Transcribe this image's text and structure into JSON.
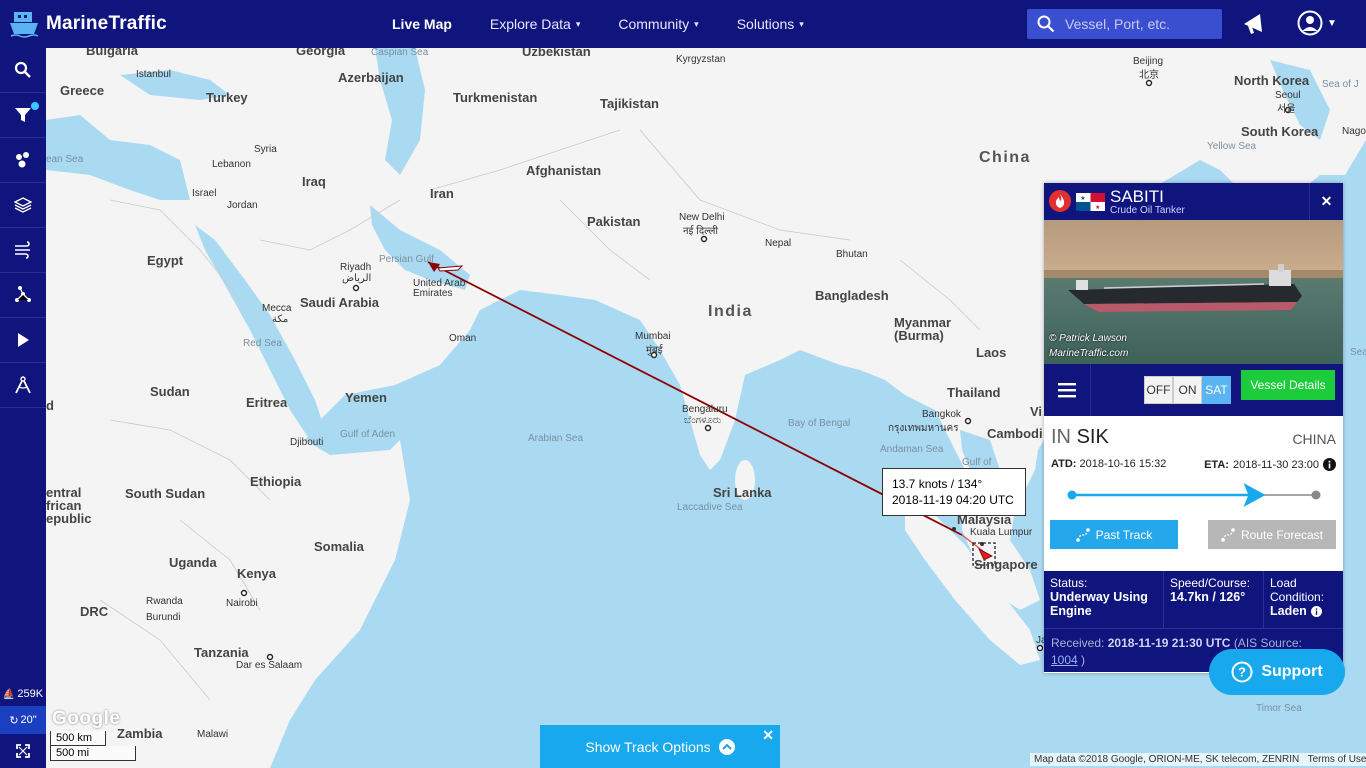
{
  "app": {
    "name": "MarineTraffic"
  },
  "nav": {
    "live_map": "Live Map",
    "explore_data": "Explore Data",
    "community": "Community",
    "solutions": "Solutions"
  },
  "search": {
    "placeholder": "Vessel, Port, etc."
  },
  "sidebar": {
    "stat_vessels": "259K",
    "stat_refresh": "20\""
  },
  "map": {
    "labels": {
      "bulgaria": "Bulgaria",
      "georgia": "Georgia",
      "caspian_sea": "Caspian Sea",
      "uzbekistan": "Uzbekistan",
      "kyrgyzstan": "Kyrgyzstan",
      "beijing": "Beijing",
      "beijing_cn": "北京",
      "north_korea": "North Korea",
      "seoul": "Seoul",
      "seoul_kr": "서울",
      "sea_of_japan": "Sea of J",
      "istanbul": "Istanbul",
      "greece": "Greece",
      "turkey": "Turkey",
      "azerbaijan": "Azerbaijan",
      "turkmenistan": "Turkmenistan",
      "tajikistan": "Tajikistan",
      "south_korea": "South Korea",
      "yellow_sea": "Yellow Sea",
      "nagoya": "Nago",
      "med_sea": "ean Sea",
      "syria": "Syria",
      "iraq": "Iraq",
      "afghanistan": "Afghanistan",
      "china": "China",
      "lebanon": "Lebanon",
      "israel": "Israel",
      "jordan": "Jordan",
      "iran": "Iran",
      "pakistan": "Pakistan",
      "new_delhi": "New Delhi",
      "new_delhi_hi": "नई दिल्ली",
      "nepal": "Nepal",
      "bhutan": "Bhutan",
      "egypt": "Egypt",
      "riyadh": "Riyadh",
      "riyadh_ar": "الرياض",
      "persian_gulf": "Persian Gulf",
      "uae": "United Arab Emirates",
      "saudi_arabia": "Saudi Arabia",
      "india": "India",
      "bangladesh": "Bangladesh",
      "myanmar": "Myanmar (Burma)",
      "mecca": "Mecca",
      "mecca_ar": "مكة",
      "oman": "Oman",
      "mumbai": "Mumbai",
      "mumbai_mr": "मुंबई",
      "laos": "Laos",
      "red_sea": "Red Sea",
      "sudan": "Sudan",
      "eritrea": "Eritrea",
      "yemen": "Yemen",
      "thailand": "Thailand",
      "bengaluru": "Bengaluru",
      "bengaluru_kn": "ಬೆಂಗಳೂರು",
      "bangkok": "Bangkok",
      "bangkok_th": "กรุงเทพมหานคร",
      "bay_of_bengal": "Bay of Bengal",
      "cambodia": "Cambodi",
      "vietnam": "Vi",
      "djibouti": "Djibouti",
      "gulf_of_aden": "Gulf of Aden",
      "arabian_sea": "Arabian Sea",
      "andaman_sea": "Andaman Sea",
      "gulf_of_thailand": "Gulf of",
      "ethiopia": "Ethiopia",
      "sri_lanka": "Sri Lanka",
      "car_1": "entral",
      "car_2": "frican",
      "car_3": "epublic",
      "south_sudan": "South Sudan",
      "laccadive_sea": "Laccadive Sea",
      "malaysia": "Malaysia",
      "kuala_lumpur": "Kuala Lumpur",
      "somalia": "Somalia",
      "uganda": "Uganda",
      "singapore": "Singapore",
      "kenya": "Kenya",
      "rwanda": "Rwanda",
      "burundi": "Burundi",
      "nairobi": "Nairobi",
      "drc": "DRC",
      "tanzania": "Tanzania",
      "dar_es_salaam": "Dar es Salaam",
      "zambia": "Zambia",
      "malawi": "Malawi",
      "timor_sea": "Timor Sea",
      "jakarta": "Jak",
      "chad_d": "d",
      "sea_right": "Sea"
    },
    "track_tip": {
      "speed": "13.7 knots / 134°",
      "time": "2018-11-19 04:20 UTC"
    },
    "google": "Google",
    "scale_km": "500 km",
    "scale_mi": "500 mi",
    "attribution": "Map data ©2018 Google, ORION-ME, SK telecom, ZENRIN",
    "terms": "Terms of Use",
    "colors": {
      "track": "#8b0000",
      "land": "#f4f4f4",
      "water": "#aadaf2"
    }
  },
  "vessel": {
    "name": "SABITI",
    "type": "Crude Oil Tanker",
    "photo_credit_1": "© Patrick Lawson",
    "photo_credit_2": "MarineTraffic.com",
    "toggle_off": "OFF",
    "toggle_on": "ON",
    "toggle_sat": "SAT",
    "details_button": "Vessel Details",
    "dest_prefix": "IN",
    "destination": "SIK",
    "dest_country": "CHINA",
    "atd_label": "ATD:",
    "atd": "2018-10-16 15:32",
    "eta_label": "ETA:",
    "eta": "2018-11-30 23:00",
    "progress": 0.76,
    "past_track": "Past Track",
    "route_forecast": "Route Forecast",
    "status_label": "Status:",
    "status": "Underway Using Engine",
    "speed_label": "Speed/Course:",
    "speed": "14.7kn / 126°",
    "load_label": "Load Condition:",
    "load": "Laden",
    "received_label": "Received:",
    "received": "2018-11-19 21:30 UTC",
    "ais_label": "(AIS Source:",
    "ais_source": "1004",
    "ais_close": ")"
  },
  "support": "Support",
  "track_options": "Show Track Options"
}
